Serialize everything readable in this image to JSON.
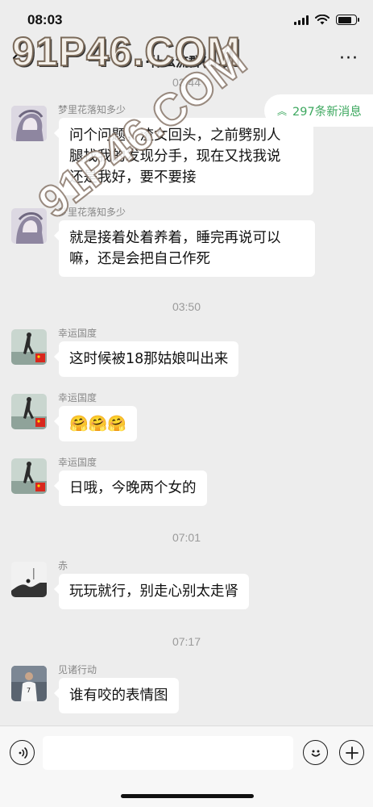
{
  "status_bar": {
    "time": "08:03"
  },
  "nav": {
    "title": "·什么流群(...)",
    "more_label": "···"
  },
  "watermark": {
    "text": "91P46.COM",
    "diagonal_text": "91P46.COM"
  },
  "new_messages": {
    "label": "297条新消息",
    "chevron": "︽"
  },
  "timestamps": [
    "03:44",
    "03:50",
    "07:01",
    "07:17"
  ],
  "messages": [
    {
      "sender": "梦里花落知多少",
      "lines": [
        "问个问题，渣女回头，之前劈别人",
        "腿找我的发现分手，现在又找我说",
        "还是我好，要不要接"
      ]
    },
    {
      "sender": "梦里花落知多少",
      "lines": [
        "就是接着处着养着，睡完再说可以",
        "嘛，还是会把自己作死"
      ]
    },
    {
      "sender": "幸运国度",
      "lines": [
        "这时候被18那姑娘叫出来"
      ]
    },
    {
      "sender": "幸运国度",
      "lines": [
        "🤗🤗🤗"
      ]
    },
    {
      "sender": "幸运国度",
      "lines": [
        "日哦，今晚两个女的"
      ]
    },
    {
      "sender": "赤",
      "lines": [
        "玩玩就行，别走心别太走肾"
      ]
    },
    {
      "sender": "见诸行动",
      "lines": [
        "谁有咬的表情图"
      ]
    }
  ],
  "input": {
    "placeholder": ""
  },
  "icons": {
    "back": "chevron-left-icon",
    "voice": "voice-icon",
    "emoji": "emoji-icon",
    "plus": "plus-icon"
  },
  "colors": {
    "accent_green": "#3da85f",
    "background": "#ededed",
    "bubble": "#ffffff"
  }
}
